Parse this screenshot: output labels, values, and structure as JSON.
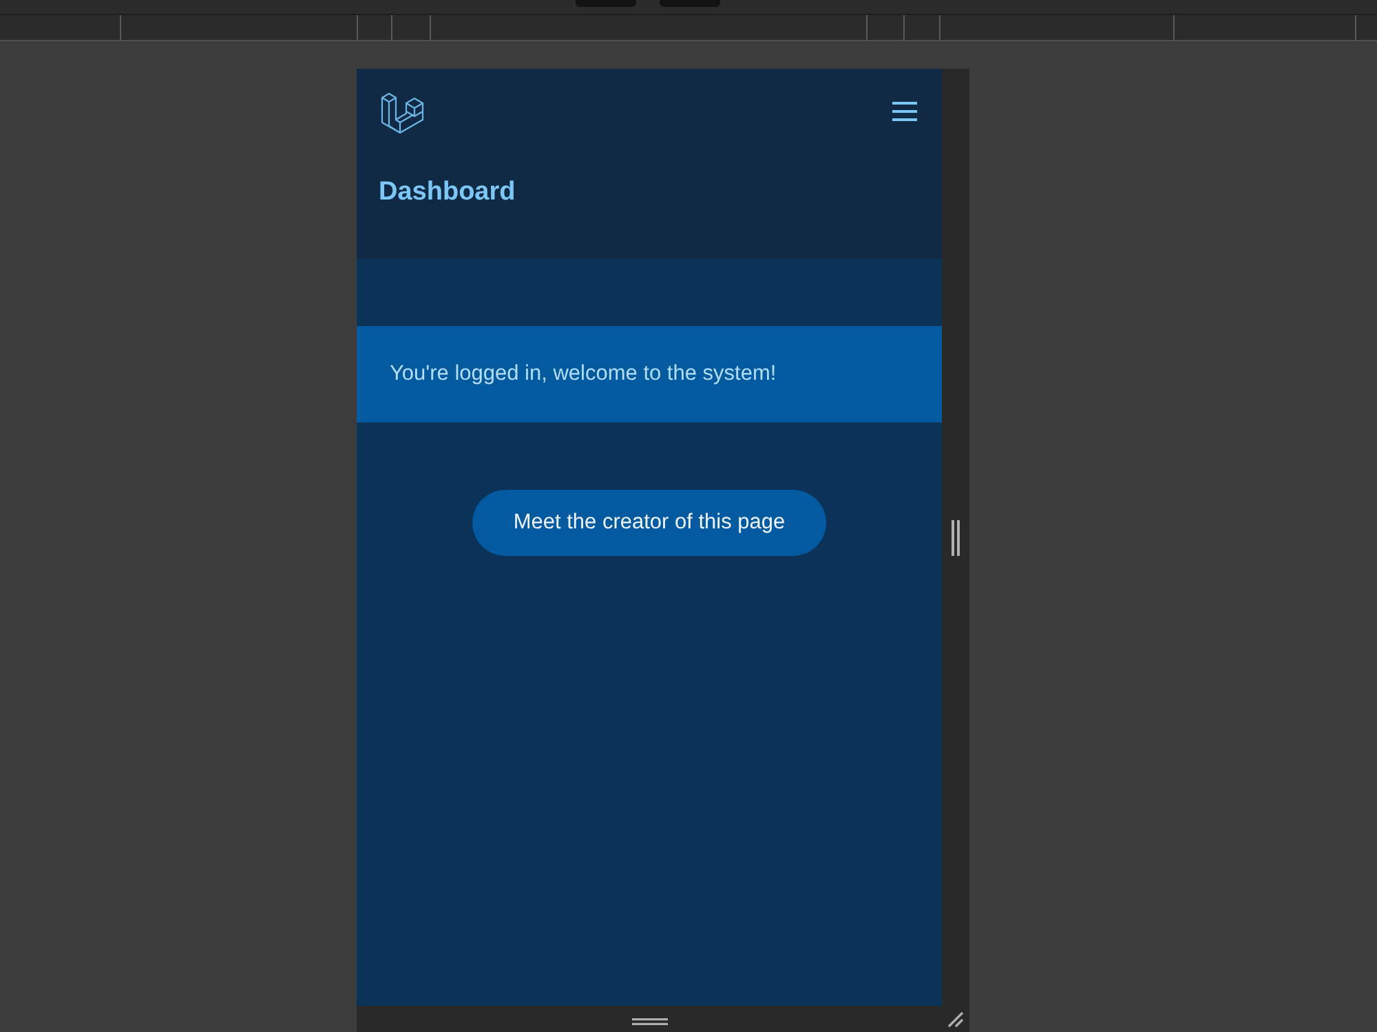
{
  "header": {
    "title": "Dashboard"
  },
  "alert": {
    "text": "You're logged in, welcome to the system!"
  },
  "cta_button": {
    "label": "Meet the creator of this page"
  }
}
